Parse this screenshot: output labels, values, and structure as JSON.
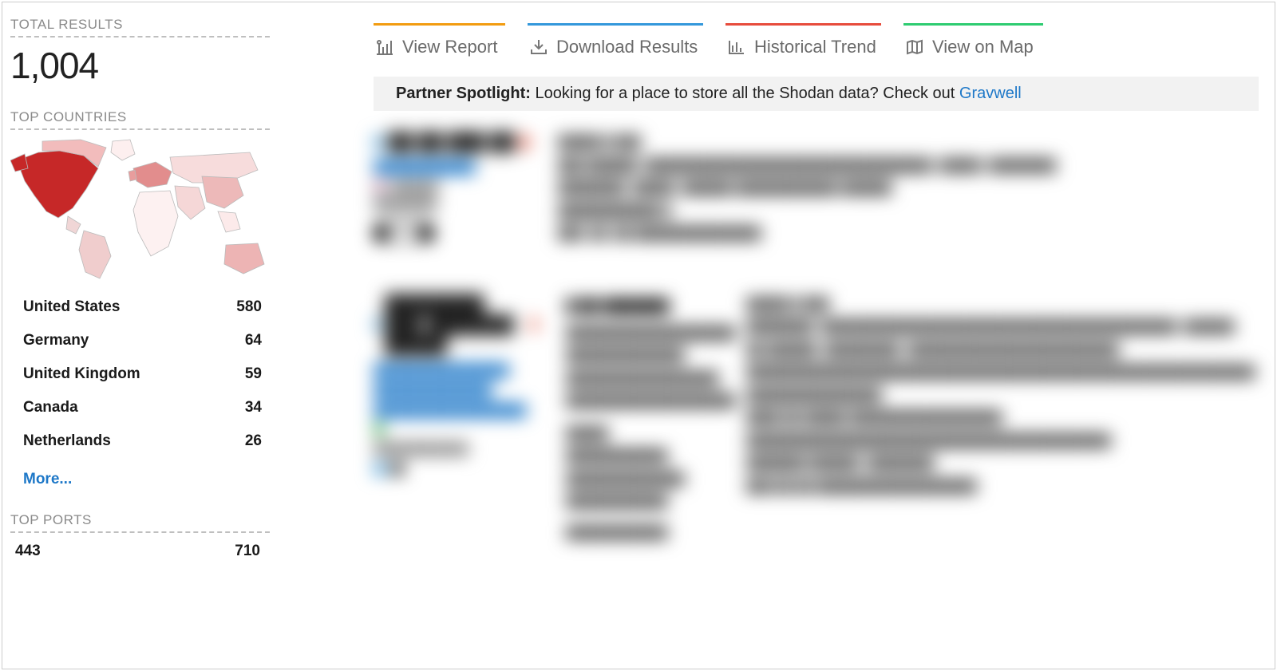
{
  "sidebar": {
    "total_results_label": "TOTAL RESULTS",
    "total_results_value": "1,004",
    "top_countries_label": "TOP COUNTRIES",
    "countries": [
      {
        "name": "United States",
        "count": "580"
      },
      {
        "name": "Germany",
        "count": "64"
      },
      {
        "name": "United Kingdom",
        "count": "59"
      },
      {
        "name": "Canada",
        "count": "34"
      },
      {
        "name": "Netherlands",
        "count": "26"
      }
    ],
    "more_label": "More...",
    "top_ports_label": "TOP PORTS",
    "ports": [
      {
        "port": "443",
        "count": "710"
      }
    ]
  },
  "actions": {
    "view_report": "View Report",
    "download_results": "Download Results",
    "historical_trend": "Historical Trend",
    "view_on_map": "View on Map"
  },
  "partner": {
    "bold": "Partner Spotlight:",
    "text": " Looking for a place to store all the Shodan data? Check out ",
    "link": "Gravwell"
  }
}
